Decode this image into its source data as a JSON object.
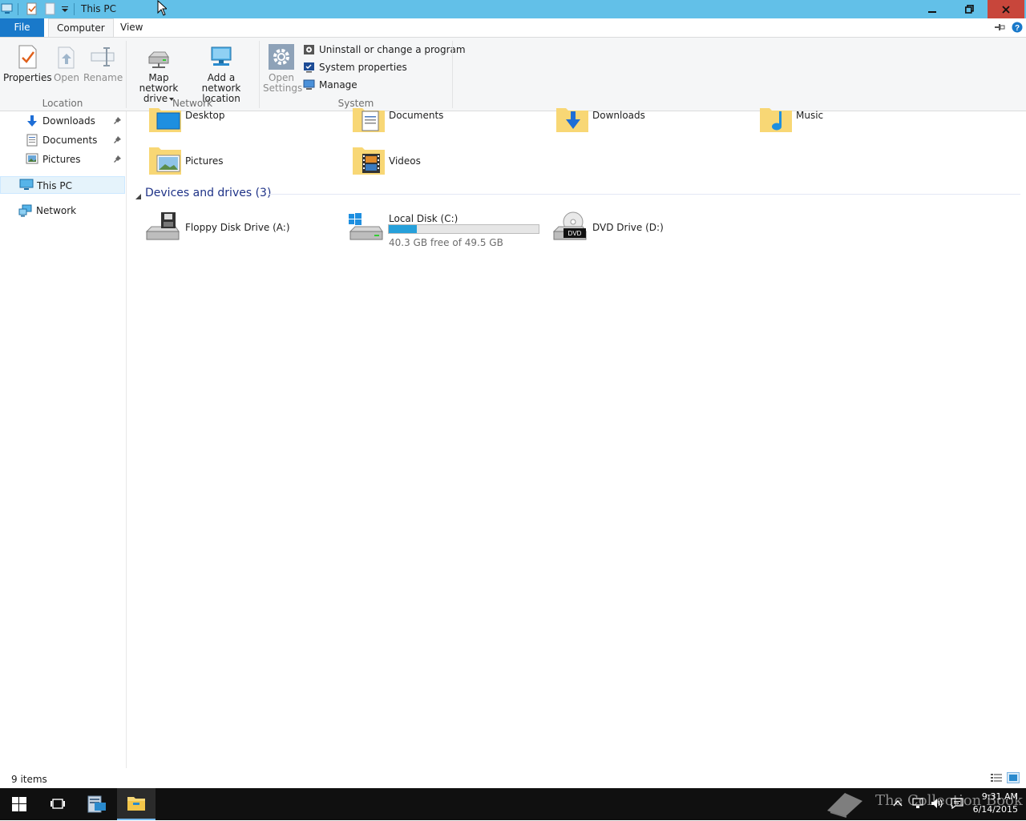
{
  "window": {
    "title": "This PC"
  },
  "menu_tabs": [
    {
      "label": "File"
    },
    {
      "label": "Computer"
    },
    {
      "label": "View"
    }
  ],
  "ribbon": {
    "location": {
      "label": "Location",
      "properties": "Properties",
      "open": "Open",
      "rename": "Rename"
    },
    "network": {
      "label": "Network",
      "map_line1": "Map network",
      "map_line2": "drive",
      "add_line1": "Add a network",
      "add_line2": "location"
    },
    "system": {
      "label": "System",
      "open_settings_line1": "Open",
      "open_settings_line2": "Settings",
      "uninstall": "Uninstall or change a program",
      "system_properties": "System properties",
      "manage": "Manage"
    }
  },
  "nav": {
    "quick_access": [
      {
        "label": "Downloads"
      },
      {
        "label": "Documents"
      },
      {
        "label": "Pictures"
      }
    ],
    "this_pc": "This PC",
    "network": "Network"
  },
  "folders": [
    {
      "label": "Desktop"
    },
    {
      "label": "Documents"
    },
    {
      "label": "Downloads"
    },
    {
      "label": "Music"
    },
    {
      "label": "Pictures"
    },
    {
      "label": "Videos"
    }
  ],
  "devices": {
    "header": "Devices and drives (3)",
    "drives": [
      {
        "label": "Floppy Disk Drive (A:)"
      },
      {
        "label": "Local Disk (C:)",
        "free_text": "40.3 GB free of 49.5 GB",
        "used_fraction": 0.186
      },
      {
        "label": "DVD Drive (D:)",
        "badge": "DVD"
      }
    ]
  },
  "status": {
    "items": "9 items"
  },
  "taskbar": {
    "time": "9:31 AM",
    "date": "6/14/2015",
    "watermark": "The Collection Book"
  },
  "colors": {
    "title_bar": "#62c0e8",
    "file_tab": "#1979ca",
    "accent": "#26a0da",
    "folder": "#f8d775"
  }
}
